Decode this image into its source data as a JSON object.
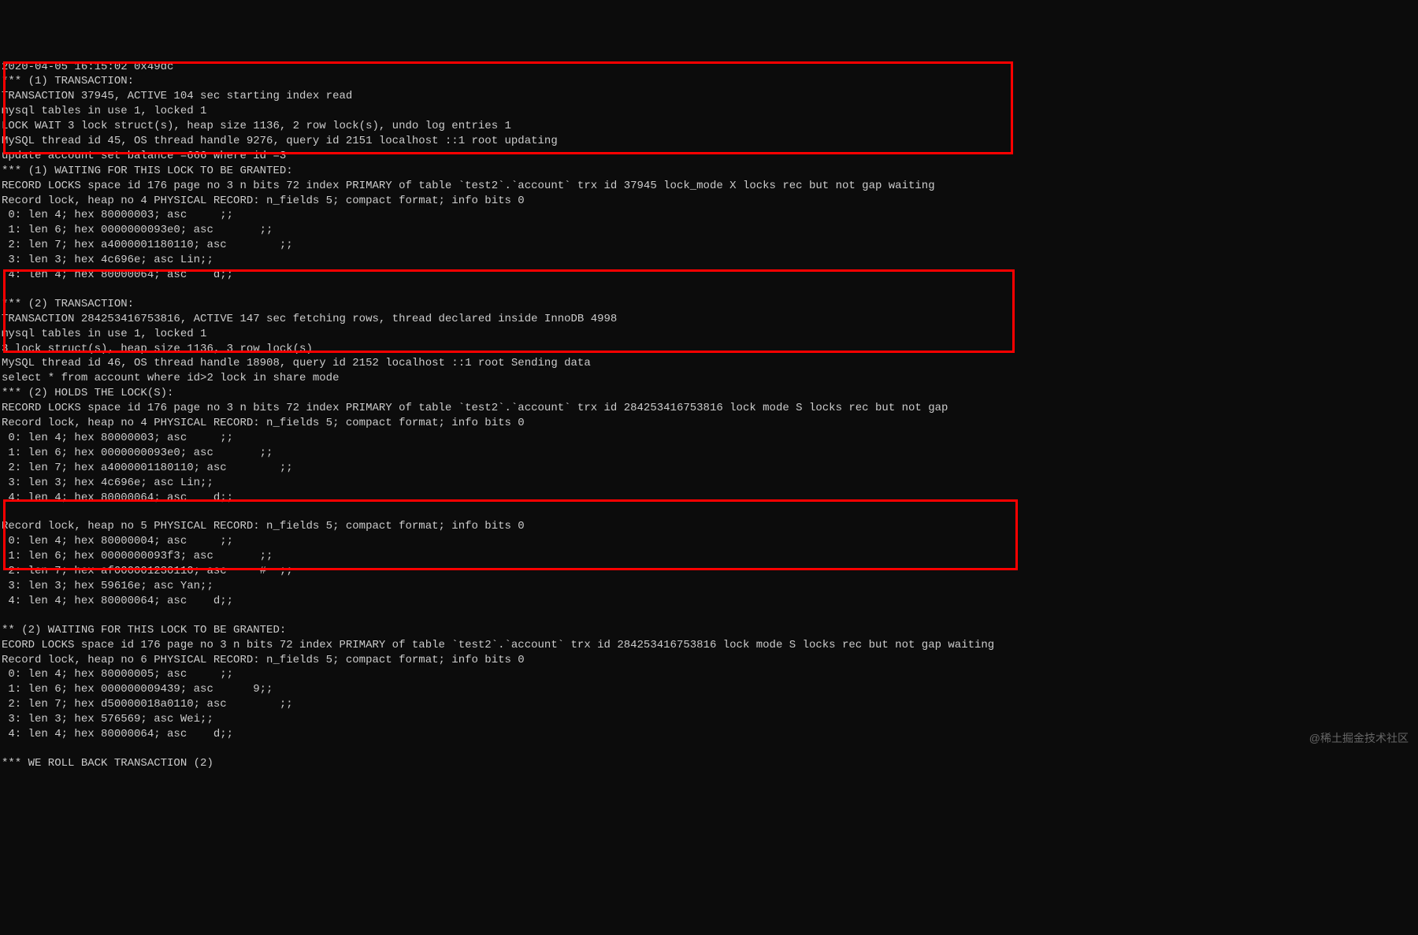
{
  "lines": [
    "2020-04-05 16:15:02 0x49dc",
    "*** (1) TRANSACTION:",
    "TRANSACTION 37945, ACTIVE 104 sec starting index read",
    "mysql tables in use 1, locked 1",
    "LOCK WAIT 3 lock struct(s), heap size 1136, 2 row lock(s), undo log entries 1",
    "MySQL thread id 45, OS thread handle 9276, query id 2151 localhost ::1 root updating",
    "update account set balance =666 where id =3",
    "*** (1) WAITING FOR THIS LOCK TO BE GRANTED:",
    "RECORD LOCKS space id 176 page no 3 n bits 72 index PRIMARY of table `test2`.`account` trx id 37945 lock_mode X locks rec but not gap waiting",
    "Record lock, heap no 4 PHYSICAL RECORD: n_fields 5; compact format; info bits 0",
    " 0: len 4; hex 80000003; asc     ;;",
    " 1: len 6; hex 0000000093e0; asc       ;;",
    " 2: len 7; hex a4000001180110; asc        ;;",
    " 3: len 3; hex 4c696e; asc Lin;;",
    " 4: len 4; hex 80000064; asc    d;;",
    "",
    "*** (2) TRANSACTION:",
    "TRANSACTION 284253416753816, ACTIVE 147 sec fetching rows, thread declared inside InnoDB 4998",
    "mysql tables in use 1, locked 1",
    "3 lock struct(s), heap size 1136, 3 row lock(s)",
    "MySQL thread id 46, OS thread handle 18908, query id 2152 localhost ::1 root Sending data",
    "select * from account where id>2 lock in share mode",
    "*** (2) HOLDS THE LOCK(S):",
    "RECORD LOCKS space id 176 page no 3 n bits 72 index PRIMARY of table `test2`.`account` trx id 284253416753816 lock mode S locks rec but not gap",
    "Record lock, heap no 4 PHYSICAL RECORD: n_fields 5; compact format; info bits 0",
    " 0: len 4; hex 80000003; asc     ;;",
    " 1: len 6; hex 0000000093e0; asc       ;;",
    " 2: len 7; hex a4000001180110; asc        ;;",
    " 3: len 3; hex 4c696e; asc Lin;;",
    " 4: len 4; hex 80000064; asc    d;;",
    "",
    "Record lock, heap no 5 PHYSICAL RECORD: n_fields 5; compact format; info bits 0",
    " 0: len 4; hex 80000004; asc     ;;",
    " 1: len 6; hex 0000000093f3; asc       ;;",
    " 2: len 7; hex af000001230110; asc     #  ;;",
    " 3: len 3; hex 59616e; asc Yan;;",
    " 4: len 4; hex 80000064; asc    d;;",
    "",
    "** (2) WAITING FOR THIS LOCK TO BE GRANTED:",
    "ECORD LOCKS space id 176 page no 3 n bits 72 index PRIMARY of table `test2`.`account` trx id 284253416753816 lock mode S locks rec but not gap waiting",
    "Record lock, heap no 6 PHYSICAL RECORD: n_fields 5; compact format; info bits 0",
    " 0: len 4; hex 80000005; asc     ;;",
    " 1: len 6; hex 000000009439; asc      9;;",
    " 2: len 7; hex d50000018a0110; asc        ;;",
    " 3: len 3; hex 576569; asc Wei;;",
    " 4: len 4; hex 80000064; asc    d;;",
    "",
    "*** WE ROLL BACK TRANSACTION (2)"
  ],
  "watermark": "@稀土掘金技术社区"
}
